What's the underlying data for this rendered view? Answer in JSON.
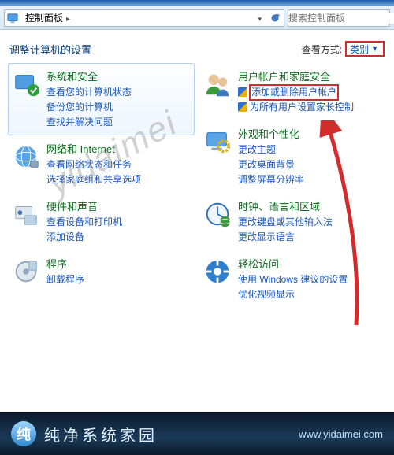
{
  "nav": {
    "breadcrumb_root": "控制面板",
    "search_placeholder": "搜索控制面板"
  },
  "subbar": {
    "heading": "调整计算机的设置",
    "view_label": "查看方式:",
    "view_value": "类别"
  },
  "left": [
    {
      "title": "系统和安全",
      "icon": "system-security-icon",
      "selected": true,
      "links": [
        {
          "text": "查看您的计算机状态",
          "shield": false
        },
        {
          "text": "备份您的计算机",
          "shield": false
        },
        {
          "text": "查找并解决问题",
          "shield": false
        }
      ]
    },
    {
      "title": "网络和 Internet",
      "icon": "network-icon",
      "links": [
        {
          "text": "查看网络状态和任务",
          "shield": false
        },
        {
          "text": "选择家庭组和共享选项",
          "shield": false
        }
      ]
    },
    {
      "title": "硬件和声音",
      "icon": "hardware-icon",
      "links": [
        {
          "text": "查看设备和打印机",
          "shield": false
        },
        {
          "text": "添加设备",
          "shield": false
        }
      ]
    },
    {
      "title": "程序",
      "icon": "programs-icon",
      "links": [
        {
          "text": "卸载程序",
          "shield": false
        }
      ]
    }
  ],
  "right": [
    {
      "title": "用户帐户和家庭安全",
      "icon": "user-accounts-icon",
      "links": [
        {
          "text": "添加或删除用户帐户",
          "shield": true,
          "highlight": true
        },
        {
          "text": "为所有用户设置家长控制",
          "shield": true
        }
      ]
    },
    {
      "title": "外观和个性化",
      "icon": "appearance-icon",
      "links": [
        {
          "text": "更改主题",
          "shield": false
        },
        {
          "text": "更改桌面背景",
          "shield": false
        },
        {
          "text": "调整屏幕分辨率",
          "shield": false
        }
      ]
    },
    {
      "title": "时钟、语言和区域",
      "icon": "clock-icon",
      "links": [
        {
          "text": "更改键盘或其他输入法",
          "shield": false
        },
        {
          "text": "更改显示语言",
          "shield": false
        }
      ]
    },
    {
      "title": "轻松访问",
      "icon": "ease-icon",
      "links": [
        {
          "text": "使用 Windows 建议的设置",
          "shield": false
        },
        {
          "text": "优化视频显示",
          "shield": false
        }
      ]
    }
  ],
  "watermark": "yidaimei",
  "footer": {
    "brand": "纯净系统家园",
    "url": "www.yidaimei.com"
  },
  "annot": {
    "highlight_color": "#d22c2c"
  }
}
